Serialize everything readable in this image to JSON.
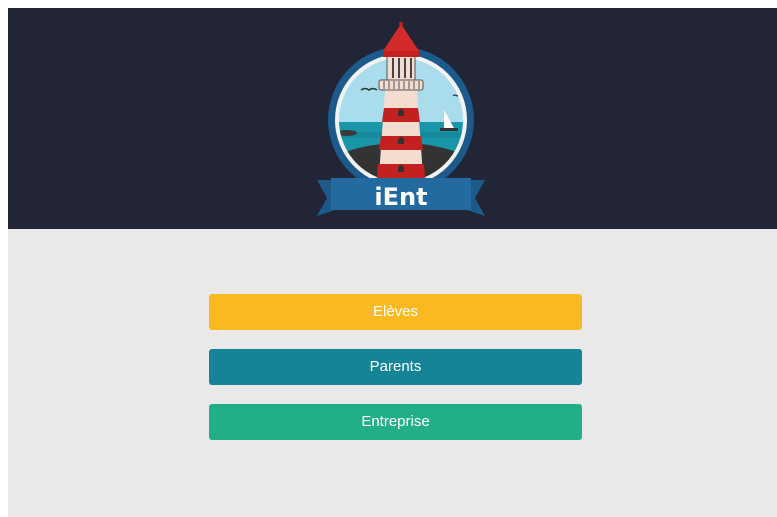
{
  "header": {
    "logo_text": "iEnt"
  },
  "buttons": {
    "eleves": "Elèves",
    "parents": "Parents",
    "entreprise": "Entreprise"
  },
  "colors": {
    "header_bg": "#212535",
    "page_bg": "#e9e9e9",
    "eleves": "#fbb921",
    "parents": "#148496",
    "entreprise": "#23ae8a"
  }
}
